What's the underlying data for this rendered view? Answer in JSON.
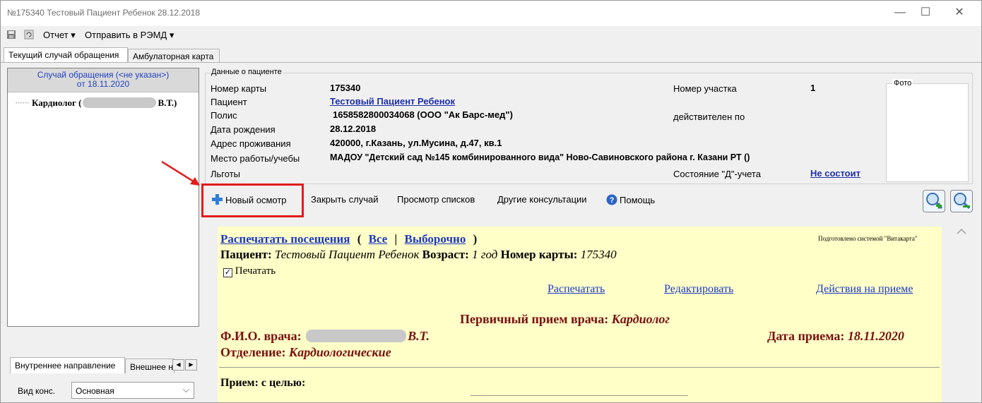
{
  "window": {
    "title": "№175340 Тестовый Пациент Ребенок 28.12.2018",
    "minimize": "—",
    "maximize": "☐",
    "close": "✕"
  },
  "toolbar": {
    "report_menu": "Отчет ▾",
    "send_menu": "Отправить в РЭМД ▾"
  },
  "tabs": [
    {
      "label": "Текущий случай обращения",
      "active": true
    },
    {
      "label": "Амбулаторная карта",
      "active": false
    }
  ],
  "left": {
    "case_line1": "Случай обращения (<не указан>)",
    "case_line2": "от 18.11.2020",
    "tree_dots": "······",
    "tree_prefix": "Кардиолог (",
    "tree_suffix": "В.Т.)"
  },
  "bottom_tabs": [
    {
      "label": "Внутреннее направление",
      "active": true
    },
    {
      "label": "Внешнее на",
      "active": false
    }
  ],
  "vid": {
    "label": "Вид конс.",
    "value": "Основная"
  },
  "patient": {
    "group_title": "Данные о пациенте",
    "card_label": "Номер карты",
    "card_value": "175340",
    "patient_label": "Пациент",
    "patient_value": "Тестовый Пациент Ребенок",
    "policy_label": "Полис",
    "policy_value": "1658582800034068 (ООО \"Ак Барс-мед\")",
    "dob_label": "Дата рождения",
    "dob_value": "28.12.2018",
    "address_label": "Адрес проживания",
    "address_value": "420000, г.Казань, ул.Мусина, д.47, кв.1",
    "work_label": "Место работы/учебы",
    "work_value": "МАДОУ \"Детский сад №145 комбинированного вида\" Ново-Савиновского района г. Казани РТ ()",
    "benefits_label": "Льготы",
    "district_label": "Номер участка",
    "district_value": "1",
    "valid_label": "действителен по",
    "d_label": "Состояние \"Д\"-учета",
    "d_value": "Не состоит",
    "photo_label": "Фото"
  },
  "actions": {
    "new_exam": "Новый осмотр",
    "close_case": "Закрыть случай",
    "view_lists": "Просмотр списков",
    "other_consult": "Другие консультации",
    "help": "Помощь"
  },
  "doc": {
    "print_visits": "Распечатать посещения",
    "paren_open": "(",
    "all": "Все",
    "sep": "|",
    "selective": "Выборочно",
    "paren_close": ")",
    "prepared_by": "Подготовлено системой \"Витакарта\"",
    "patient_label": "Пациент:",
    "patient_value": "Тестовый Пациент Ребенок",
    "age_label": "Возраст:",
    "age_value": "1 год",
    "card_label": "Номер карты:",
    "card_value": "175340",
    "print_checkbox": "Печатать",
    "print_link": "Распечатать",
    "edit_link": "Редактировать",
    "actions_link": "Действия на приеме",
    "heading_label": "Первичный прием врача:",
    "heading_value": "Кардиолог",
    "doctor_label": "Ф.И.О. врача:",
    "doctor_suffix": "В.Т.",
    "date_label": "Дата приема:",
    "date_value": "18.11.2020",
    "dept_label": "Отделение:",
    "dept_value": "Кардиологические",
    "purpose_label": "Прием: с целью:"
  },
  "colors": {
    "highlight_red": "#e21b1b",
    "doc_background": "#ffffc8",
    "link_blue": "#1c38c7",
    "maroon": "#7a1010"
  }
}
